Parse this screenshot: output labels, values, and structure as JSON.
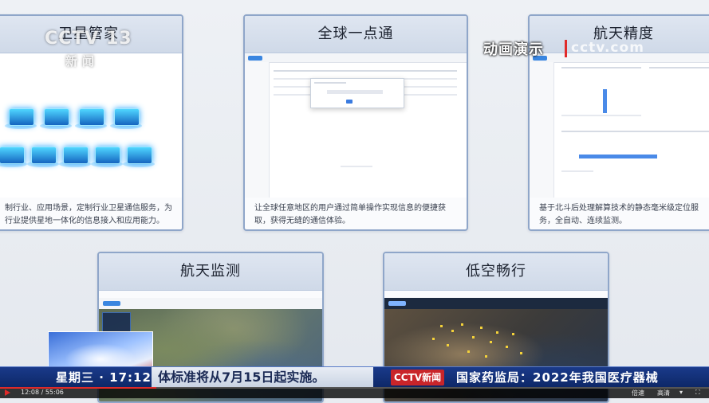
{
  "cards": [
    {
      "title": "卫星管家",
      "desc": "制行业、应用场景，定制行业卫星通信服务，为行业提供星地一体化的信息接入和应用能力。"
    },
    {
      "title": "全球一点通",
      "desc": "让全球任意地区的用户通过简单操作实现信息的便捷获取，获得无缝的通信体验。"
    },
    {
      "title": "航天精度",
      "desc": "基于北斗后处理解算技术的静态毫米级定位服务，全自动、连续监测。"
    },
    {
      "title": "航天监测",
      "desc": ""
    },
    {
      "title": "低空畅行",
      "desc": ""
    }
  ],
  "overlay": {
    "channel_logo": "CCTV 13",
    "channel_sub": "新闻",
    "animation_label": "动画演示",
    "animation_watermark": "cctv.com"
  },
  "ticker": {
    "day_time": "星期三 · 17:12",
    "scroll_text": "体标准将从7月15日起实施。",
    "badge": "CCTV新闻",
    "right_text": "国家药监局：2022年我国医疗器械"
  },
  "player": {
    "time": "12:08 / 55:06",
    "speed": "倍速",
    "quality": "高清",
    "progress": 0.22
  },
  "colors": {
    "card_border": "#8fa6c9",
    "ticker_bg": "#0d2766",
    "accent_red": "#e02a2a"
  }
}
